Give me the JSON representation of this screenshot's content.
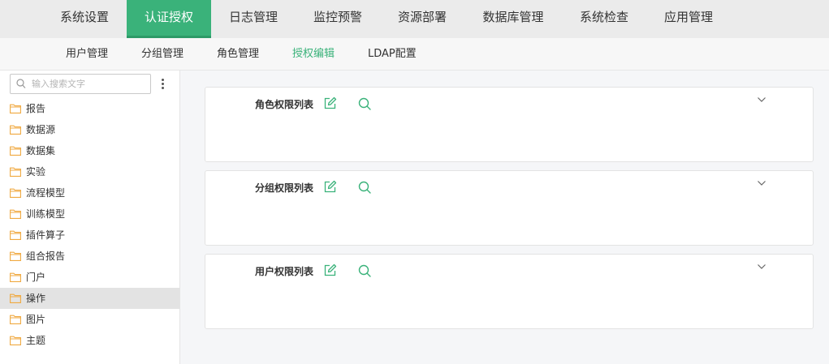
{
  "top_nav": {
    "tabs": [
      {
        "label": "系统设置"
      },
      {
        "label": "认证授权"
      },
      {
        "label": "日志管理"
      },
      {
        "label": "监控预警"
      },
      {
        "label": "资源部署"
      },
      {
        "label": "数据库管理"
      },
      {
        "label": "系统检查"
      },
      {
        "label": "应用管理"
      }
    ],
    "active": "认证授权"
  },
  "sub_nav": {
    "items": [
      {
        "label": "用户管理"
      },
      {
        "label": "分组管理"
      },
      {
        "label": "角色管理"
      },
      {
        "label": "授权编辑"
      },
      {
        "label": "LDAP配置"
      }
    ],
    "active": "授权编辑"
  },
  "sidebar": {
    "search": {
      "placeholder": "输入搜索文字",
      "value": ""
    },
    "items": [
      {
        "label": "报告",
        "icon": "folder-icon"
      },
      {
        "label": "数据源",
        "icon": "folder-icon"
      },
      {
        "label": "数据集",
        "icon": "folder-icon"
      },
      {
        "label": "实验",
        "icon": "folder-icon"
      },
      {
        "label": "流程模型",
        "icon": "folder-icon"
      },
      {
        "label": "训练模型",
        "icon": "folder-icon"
      },
      {
        "label": "插件算子",
        "icon": "folder-icon"
      },
      {
        "label": "组合报告",
        "icon": "folder-icon"
      },
      {
        "label": "门户",
        "icon": "folder-icon"
      },
      {
        "label": "操作",
        "icon": "folder-icon"
      },
      {
        "label": "图片",
        "icon": "folder-icon"
      },
      {
        "label": "主题",
        "icon": "folder-icon"
      }
    ],
    "selected": "操作"
  },
  "panels": [
    {
      "title": "角色权限列表"
    },
    {
      "title": "分组权限列表"
    },
    {
      "title": "用户权限列表"
    }
  ],
  "colors": {
    "accent": "#3ab27a",
    "folder": "#f0a940",
    "nav_bg": "#ebebeb"
  }
}
